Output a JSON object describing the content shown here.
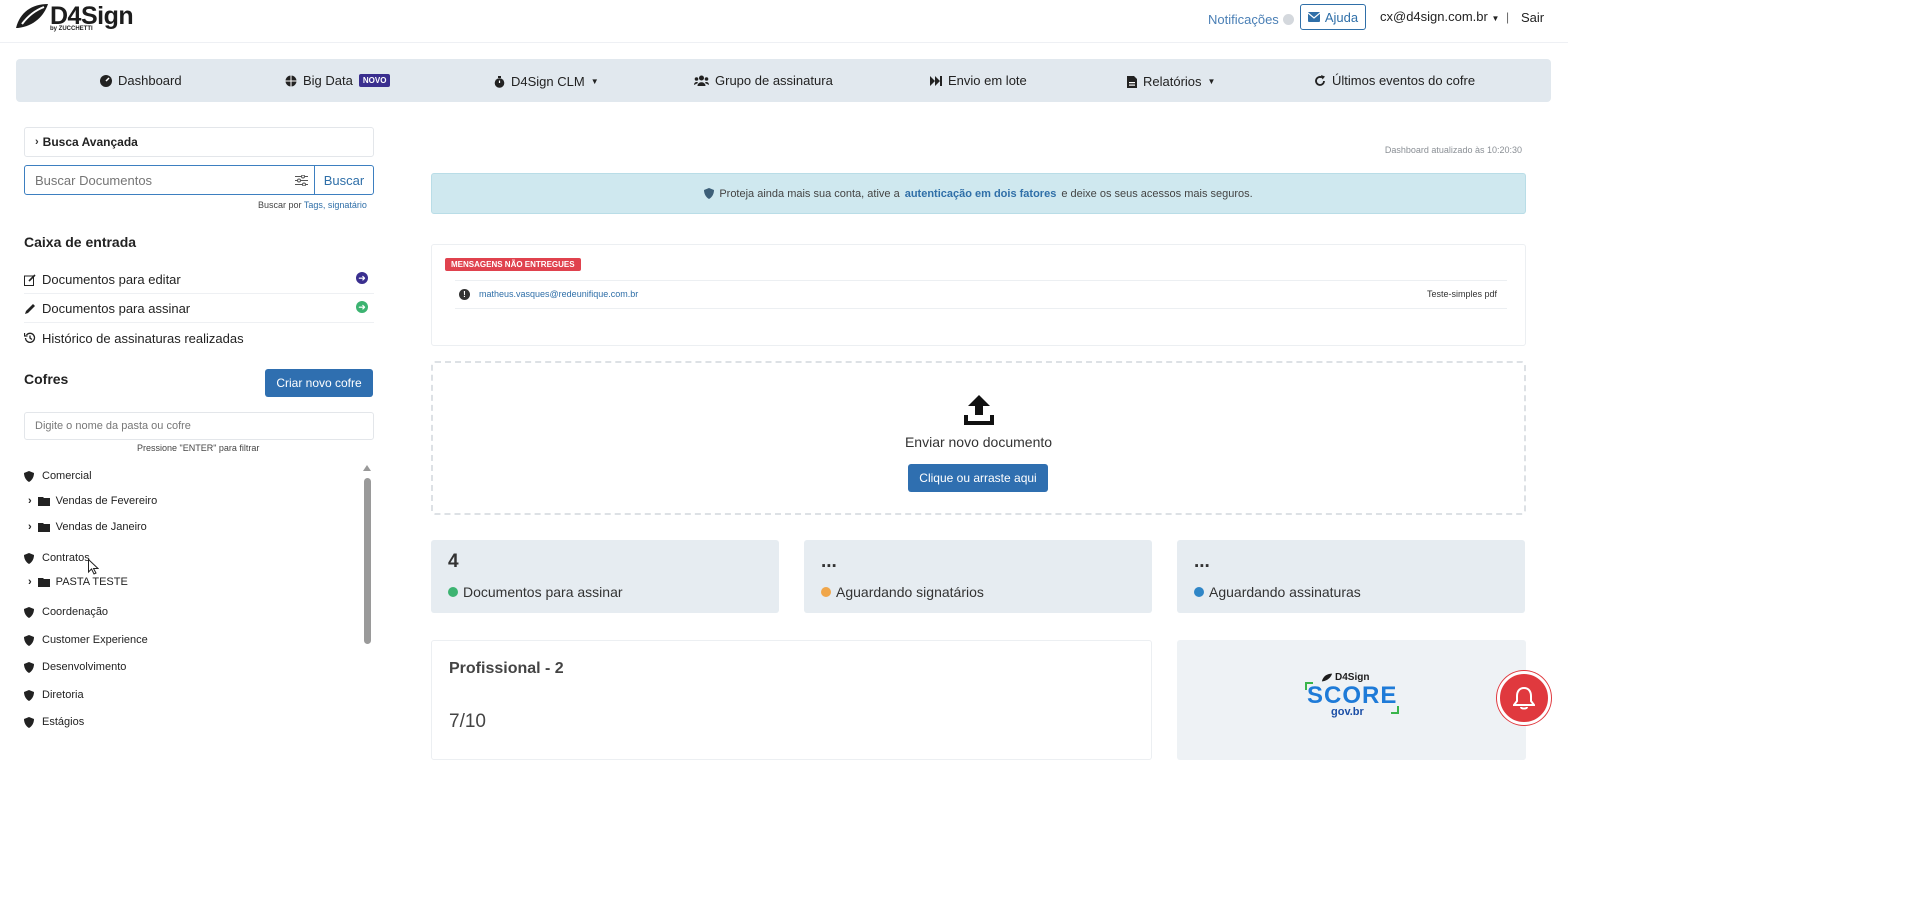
{
  "brand": {
    "name": "D4Sign",
    "sub": "by ZUCCHETTI"
  },
  "topbar": {
    "notifications": "Notificações",
    "help": "Ajuda",
    "user": "cx@d4sign.com.br",
    "separator": "|",
    "logout": "Sair"
  },
  "nav": {
    "dashboard": "Dashboard",
    "bigdata": "Big Data",
    "bigdata_badge": "NOVO",
    "clm": "D4Sign CLM",
    "grupo": "Grupo de assinatura",
    "lote": "Envio em lote",
    "relatorios": "Relatórios",
    "eventos": "Últimos eventos do cofre"
  },
  "sidebar": {
    "busca_avancada": "Busca Avançada",
    "search_placeholder": "Buscar Documentos",
    "search_button": "Buscar",
    "search_hint_prefix": "Buscar por ",
    "search_hint_links": "Tags, signatário",
    "inbox_title": "Caixa de entrada",
    "inbox_items": [
      "Documentos para editar",
      "Documentos para assinar",
      "Histórico de assinaturas realizadas"
    ],
    "cofres_title": "Cofres",
    "new_cofre": "Criar novo cofre",
    "folder_placeholder": "Digite o nome da pasta ou cofre",
    "folder_hint": "Pressione \"ENTER\" para filtrar",
    "tree": {
      "comercial": "Comercial",
      "fev": "Vendas de Fevereiro",
      "jan": "Vendas de Janeiro",
      "contratos": "Contratos",
      "pasta": "PASTA TESTE",
      "coord": "Coordenação",
      "cx": "Customer Experience",
      "dev": "Desenvolvimento",
      "dir": "Diretoria",
      "est": "Estágios"
    }
  },
  "main": {
    "updated": "Dashboard atualizado às 10:20:30",
    "alert_prefix": "Proteja ainda mais sua conta, ative a",
    "alert_link": "autenticação em dois fatores",
    "alert_suffix": "e deixe os seus acessos mais seguros.",
    "msg_badge": "MENSAGENS NÃO ENTREGUES",
    "msg_email": "matheus.vasques@redeunifique.com.br",
    "msg_doc": "Teste-simples pdf",
    "upload_title": "Enviar novo documento",
    "upload_button": "Clique ou arraste aqui",
    "stats": [
      {
        "value": "4",
        "label": "Documentos para assinar",
        "color": "#3cb371"
      },
      {
        "value": "...",
        "label": "Aguardando signatários",
        "color": "#f0a64a"
      },
      {
        "value": "...",
        "label": "Aguardando assinaturas",
        "color": "#2f86c7"
      }
    ],
    "plan_title": "Profissional - 2",
    "plan_usage": "7/10",
    "score_brand": "D4Sign",
    "score_word": "SCORE",
    "score_gov": "gov.br"
  }
}
